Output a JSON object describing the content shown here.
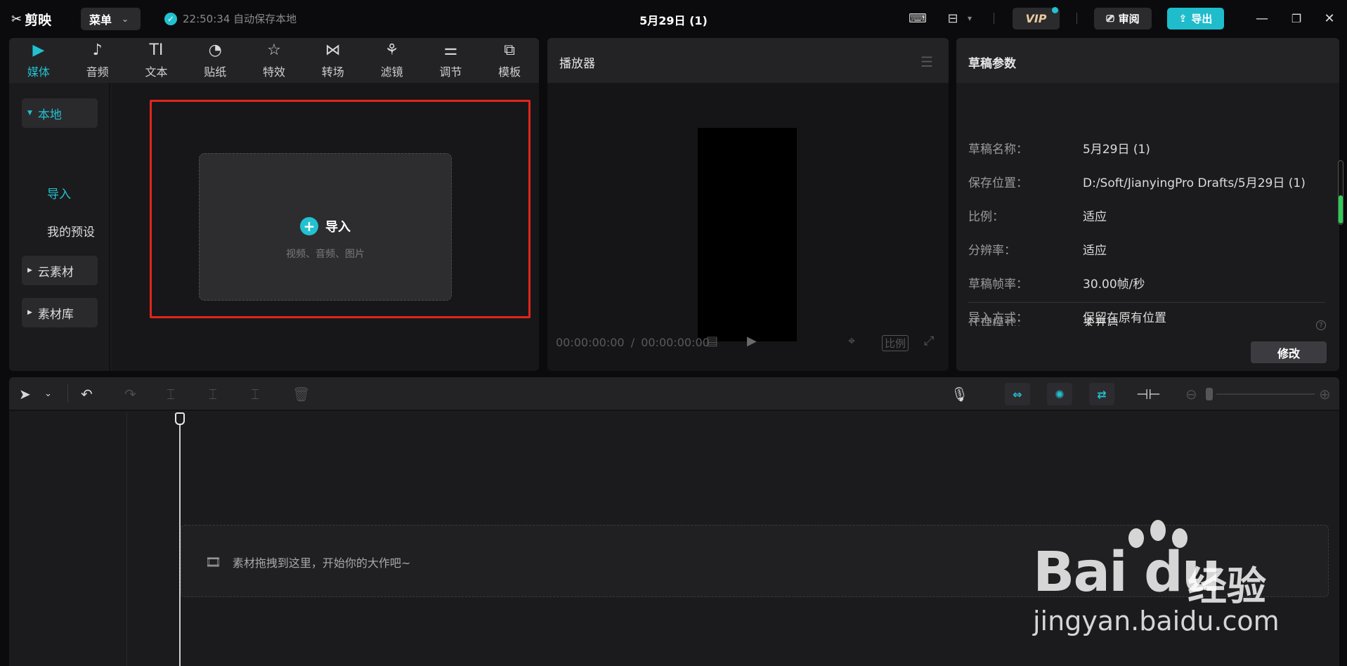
{
  "titlebar": {
    "app_name": "剪映",
    "menu_label": "菜单",
    "autosave_text": "22:50:34 自动保存本地",
    "doc_title": "5月29日 (1)",
    "vip_label": "VIP",
    "review_label": "审阅",
    "export_label": "导出"
  },
  "media_panel": {
    "tools": [
      {
        "label": "媒体",
        "icon": "media-icon",
        "glyph": "▶"
      },
      {
        "label": "音频",
        "icon": "audio-icon",
        "glyph": "♪"
      },
      {
        "label": "文本",
        "icon": "text-icon",
        "glyph": "TI"
      },
      {
        "label": "贴纸",
        "icon": "sticker-icon",
        "glyph": "◔"
      },
      {
        "label": "特效",
        "icon": "effects-icon",
        "glyph": "☆"
      },
      {
        "label": "转场",
        "icon": "transition-icon",
        "glyph": "⋈"
      },
      {
        "label": "滤镜",
        "icon": "filter-icon",
        "glyph": "⚘"
      },
      {
        "label": "调节",
        "icon": "adjust-icon",
        "glyph": "⚌"
      },
      {
        "label": "模板",
        "icon": "template-icon",
        "glyph": "⧉"
      }
    ],
    "side": {
      "local": "本地",
      "import": "导入",
      "my_presets": "我的预设",
      "cloud": "云素材",
      "library": "素材库"
    },
    "import_card": {
      "title": "导入",
      "subtitle": "视频、音频、图片"
    }
  },
  "player": {
    "title": "播放器",
    "current_time": "00:00:00:00",
    "total_time": "00:00:00:00",
    "ratio_label": "比例"
  },
  "params": {
    "title": "草稿参数",
    "rows": [
      {
        "label": "草稿名称：",
        "value": "5月29日 (1)"
      },
      {
        "label": "保存位置：",
        "value": "D:/Soft/JianyingPro Drafts/5月29日 (1)"
      },
      {
        "label": "比例：",
        "value": "适应"
      },
      {
        "label": "分辨率：",
        "value": "适应"
      },
      {
        "label": "草稿帧率：",
        "value": "30.00帧/秒"
      },
      {
        "label": "导入方式：",
        "value": "保留在原有位置"
      },
      {
        "label": "代理模式：",
        "value": "未开启"
      }
    ],
    "modify_label": "修改"
  },
  "timeline": {
    "drop_hint": "素材拖拽到这里，开始你的大作吧~"
  },
  "watermark": {
    "brand": "Bai du",
    "suffix": "经验",
    "url": "jingyan.baidu.com"
  },
  "colors": {
    "accent": "#22c1cf",
    "highlight_box": "#e1251b",
    "background": "#0b0b0d",
    "panel": "#1b1b1d"
  }
}
